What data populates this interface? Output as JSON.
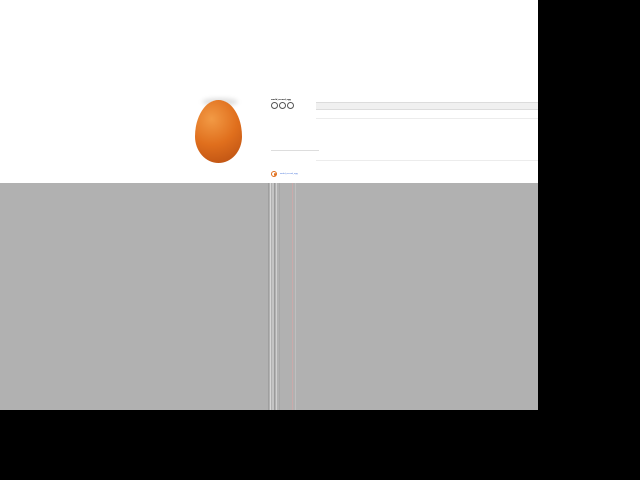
{
  "post": {
    "header_small": "",
    "username": "world_record_egg",
    "lines": [
      "",
      "",
      "",
      "",
      "",
      "",
      "",
      "",
      "",
      ""
    ],
    "comment_block": [
      "",
      "",
      "",
      ""
    ],
    "profile_name": "world_record_egg"
  },
  "colors": {
    "egg": "#e06f1d",
    "gray_area": "#b1b1b1",
    "link": "#3a6ad8"
  },
  "icons": [
    "heart-icon",
    "comment-icon",
    "share-icon",
    "avatar-icon"
  ]
}
